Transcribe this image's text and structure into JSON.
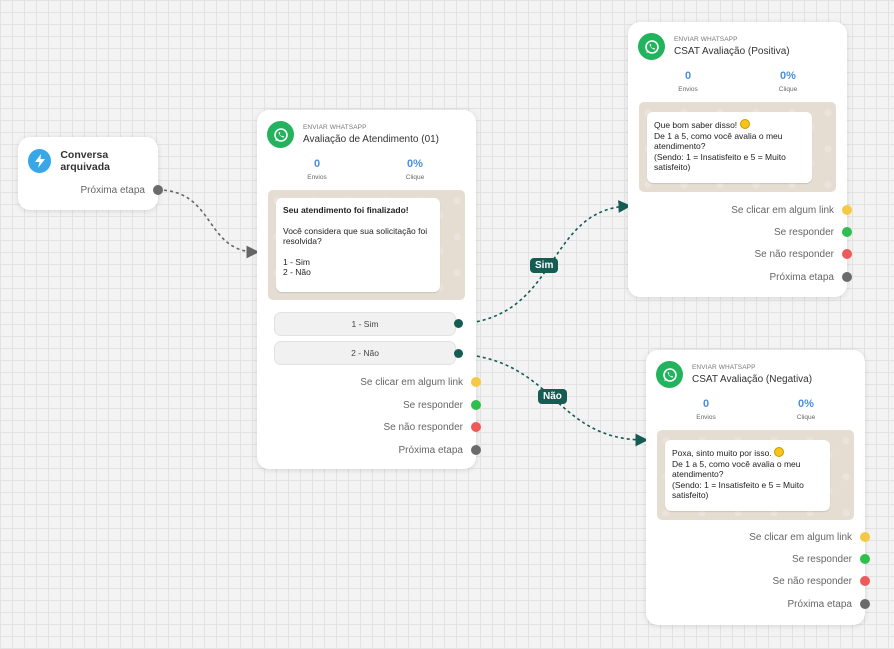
{
  "trigger": {
    "title": "Conversa arquivada",
    "next_label": "Próxima etapa",
    "icon": "lightning-icon",
    "icon_color": "#38a7e8"
  },
  "main_node": {
    "subtitle": "ENVIAR WHATSAPP",
    "title": "Avaliação de Atendimento (01)",
    "stats": [
      {
        "value": "0",
        "label": "Envios"
      },
      {
        "value": "0%",
        "label": "Clique"
      }
    ],
    "message": {
      "heading": "Seu atendimento foi finalizado!",
      "body": "Você considera que sua solicitação foi resolvida?",
      "options_text": "1 - Sim\n2 - Não"
    },
    "options": [
      "1 - Sim",
      "2 - Não"
    ],
    "outputs": [
      {
        "label": "Se clicar em algum link",
        "color": "#f7c843"
      },
      {
        "label": "Se responder",
        "color": "#2fbf4e"
      },
      {
        "label": "Se não responder",
        "color": "#ee5a5a"
      },
      {
        "label": "Próxima etapa",
        "color": "#6b6b6b"
      }
    ]
  },
  "positive_node": {
    "subtitle": "ENVIAR WHATSAPP",
    "title": "CSAT Avaliação (Positiva)",
    "stats": [
      {
        "value": "0",
        "label": "Envios"
      },
      {
        "value": "0%",
        "label": "Clique"
      }
    ],
    "message": {
      "text": "Que bom saber disso!",
      "body": "De 1 a 5, como você avalia o meu atendimento?\n(Sendo: 1 = Insatisfeito e 5 = Muito satisfeito)"
    },
    "outputs": [
      {
        "label": "Se clicar em algum link",
        "color": "#f7c843"
      },
      {
        "label": "Se responder",
        "color": "#2fbf4e"
      },
      {
        "label": "Se não responder",
        "color": "#ee5a5a"
      },
      {
        "label": "Próxima etapa",
        "color": "#6b6b6b"
      }
    ]
  },
  "negative_node": {
    "subtitle": "ENVIAR WHATSAPP",
    "title": "CSAT Avaliação (Negativa)",
    "stats": [
      {
        "value": "0",
        "label": "Envios"
      },
      {
        "value": "0%",
        "label": "Clique"
      }
    ],
    "message": {
      "text": "Poxa, sinto muito por isso.",
      "body": "De 1 a 5, como você avalia o meu atendimento?\n(Sendo: 1 = Insatisfeito e 5 = Muito satisfeito)"
    },
    "outputs": [
      {
        "label": "Se clicar em algum link",
        "color": "#f7c843"
      },
      {
        "label": "Se responder",
        "color": "#2fbf4e"
      },
      {
        "label": "Se não responder",
        "color": "#ee5a5a"
      },
      {
        "label": "Próxima etapa",
        "color": "#6b6b6b"
      }
    ]
  },
  "edges": {
    "yes_label": "Sim",
    "no_label": "Não",
    "line_color": "#155c52",
    "connector_color": "#666666"
  },
  "icons": {
    "whatsapp": "whatsapp-icon",
    "emoji_happy": "smile-emoji-icon",
    "emoji_sad": "sad-emoji-icon"
  }
}
